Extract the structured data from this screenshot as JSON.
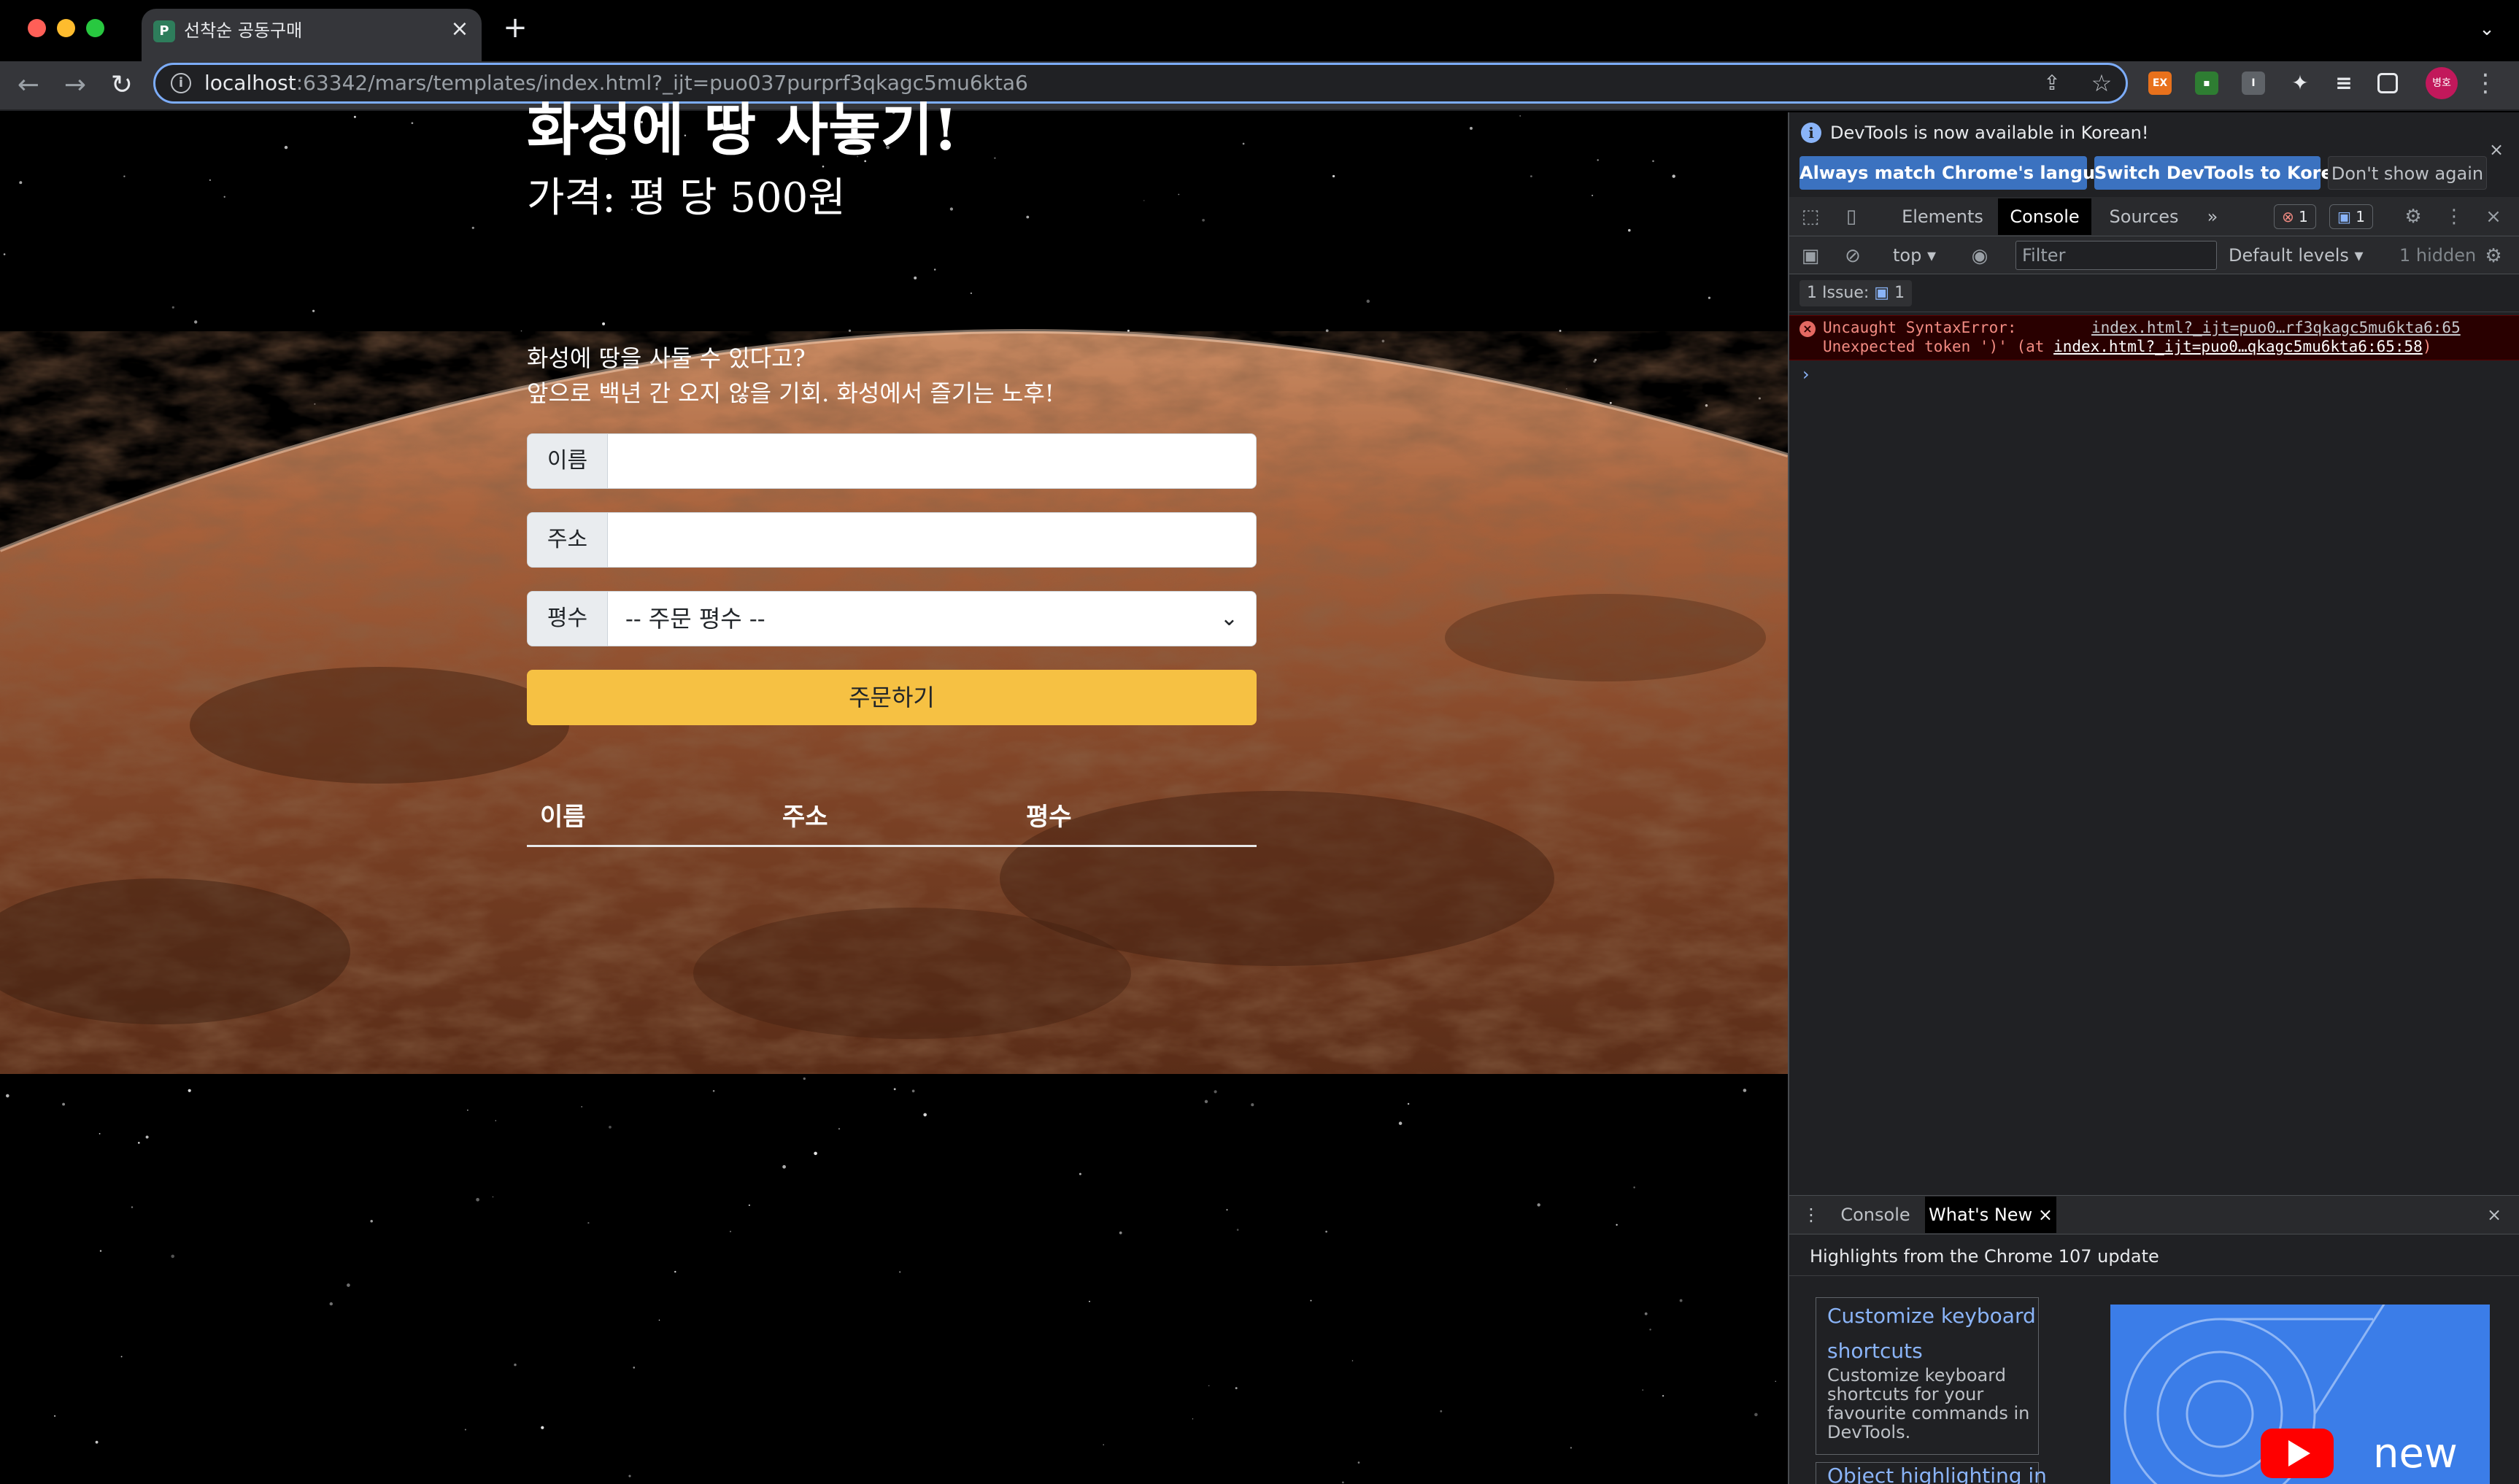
{
  "browser": {
    "tab_title": "선착순 공동구매",
    "url_host": "localhost",
    "url_rest": ":63342/mars/templates/index.html?_ijt=puo037purprf3qkagc5mu6kta6",
    "profile_label": "병호",
    "ext1_label": "EX",
    "ext3_label": "I"
  },
  "page": {
    "title": "화성에 땅 사놓기!",
    "price": "가격: 평 당 500원",
    "desc_line1": "화성에 땅을 사둘 수 있다고?",
    "desc_line2": "앞으로 백년 간 오지 않을 기회. 화성에서 즐기는 노후!",
    "form": {
      "name_label": "이름",
      "name_value": "",
      "address_label": "주소",
      "address_value": "",
      "size_label": "평수",
      "size_selected": "-- 주문 평수 --"
    },
    "order_button": "주문하기",
    "table_headers": [
      "이름",
      "주소",
      "평수"
    ]
  },
  "devtools": {
    "info_text": "DevTools is now available in Korean!",
    "btn_match": "Always match Chrome's language",
    "btn_switch": "Switch DevTools to Korean",
    "btn_dont": "Don't show again",
    "tabs": [
      "Elements",
      "Console",
      "Sources"
    ],
    "more_tabs": "»",
    "error_count": "1",
    "message_count": "1",
    "context": "top",
    "filter_placeholder": "Filter",
    "levels": "Default levels",
    "hidden": "1 hidden",
    "issues_label": "1 Issue:",
    "issues_count": "1",
    "error_line1": "Uncaught SyntaxError:",
    "error_line1_src": "index.html?_ijt=puo0…rf3qkagc5mu6kta6:65",
    "error_line2_prefix": "Unexpected token ')' (at ",
    "error_line2_link": "index.html?_ijt=puo0…qkagc5mu6kta6:65:58",
    "error_line2_suffix": ")",
    "prompt": "›",
    "drawer_tabs": [
      "Console",
      "What's New"
    ],
    "highlights": "Highlights from the Chrome 107 update",
    "card1_title": "Customize keyboard shortcuts",
    "card1_desc": "Customize keyboard shortcuts for your favourite commands in DevTools.",
    "card2_title": "Object highlighting in",
    "promo_text": "new"
  },
  "colors": {
    "accent_button": "#f6c143",
    "devtools_bg": "#202124",
    "error_bg": "#290000",
    "link_blue": "#8ab4f8"
  }
}
